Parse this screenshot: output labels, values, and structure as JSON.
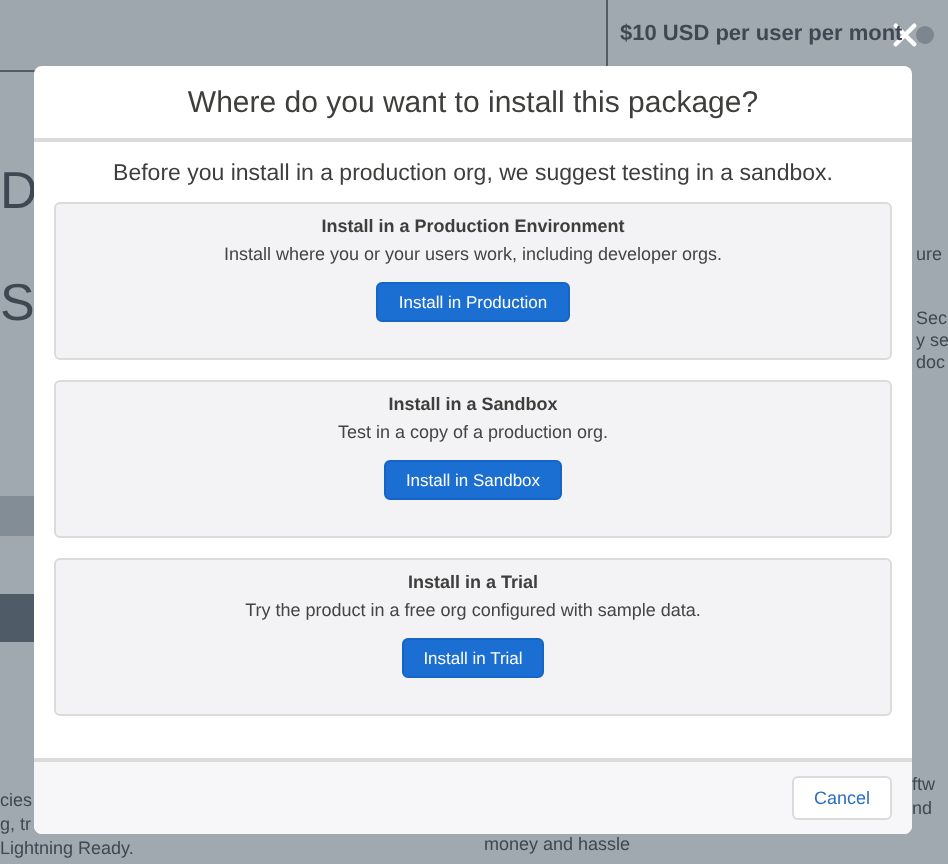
{
  "background": {
    "price": "$10 USD per user per mont",
    "fragments": [
      {
        "kind": "heading",
        "text": "D"
      },
      {
        "kind": "heading",
        "text": "S"
      },
      {
        "kind": "side",
        "text": "ure"
      },
      {
        "kind": "side",
        "text": "Sec"
      },
      {
        "kind": "side",
        "text": "y se"
      },
      {
        "kind": "side",
        "text": "doc"
      },
      {
        "kind": "foot",
        "text": "cies"
      },
      {
        "kind": "foot",
        "text": "g, tr"
      },
      {
        "kind": "foot",
        "text": "Lightning Ready."
      },
      {
        "kind": "foot",
        "text": "ftw"
      },
      {
        "kind": "foot",
        "text": "nd"
      },
      {
        "kind": "foot",
        "text": "money and hassle"
      }
    ]
  },
  "modal": {
    "title": "Where do you want to install this package?",
    "intro": "Before you install in a production org, we suggest testing in a sandbox.",
    "options": [
      {
        "title": "Install in a Production Environment",
        "description": "Install where you or your users work, including developer orgs.",
        "button": "Install in Production"
      },
      {
        "title": "Install in a Sandbox",
        "description": "Test in a copy of a production org.",
        "button": "Install in Sandbox"
      },
      {
        "title": "Install in a Trial",
        "description": "Try the product in a free org configured with sample data.",
        "button": "Install in Trial"
      }
    ],
    "cancel": "Cancel"
  }
}
